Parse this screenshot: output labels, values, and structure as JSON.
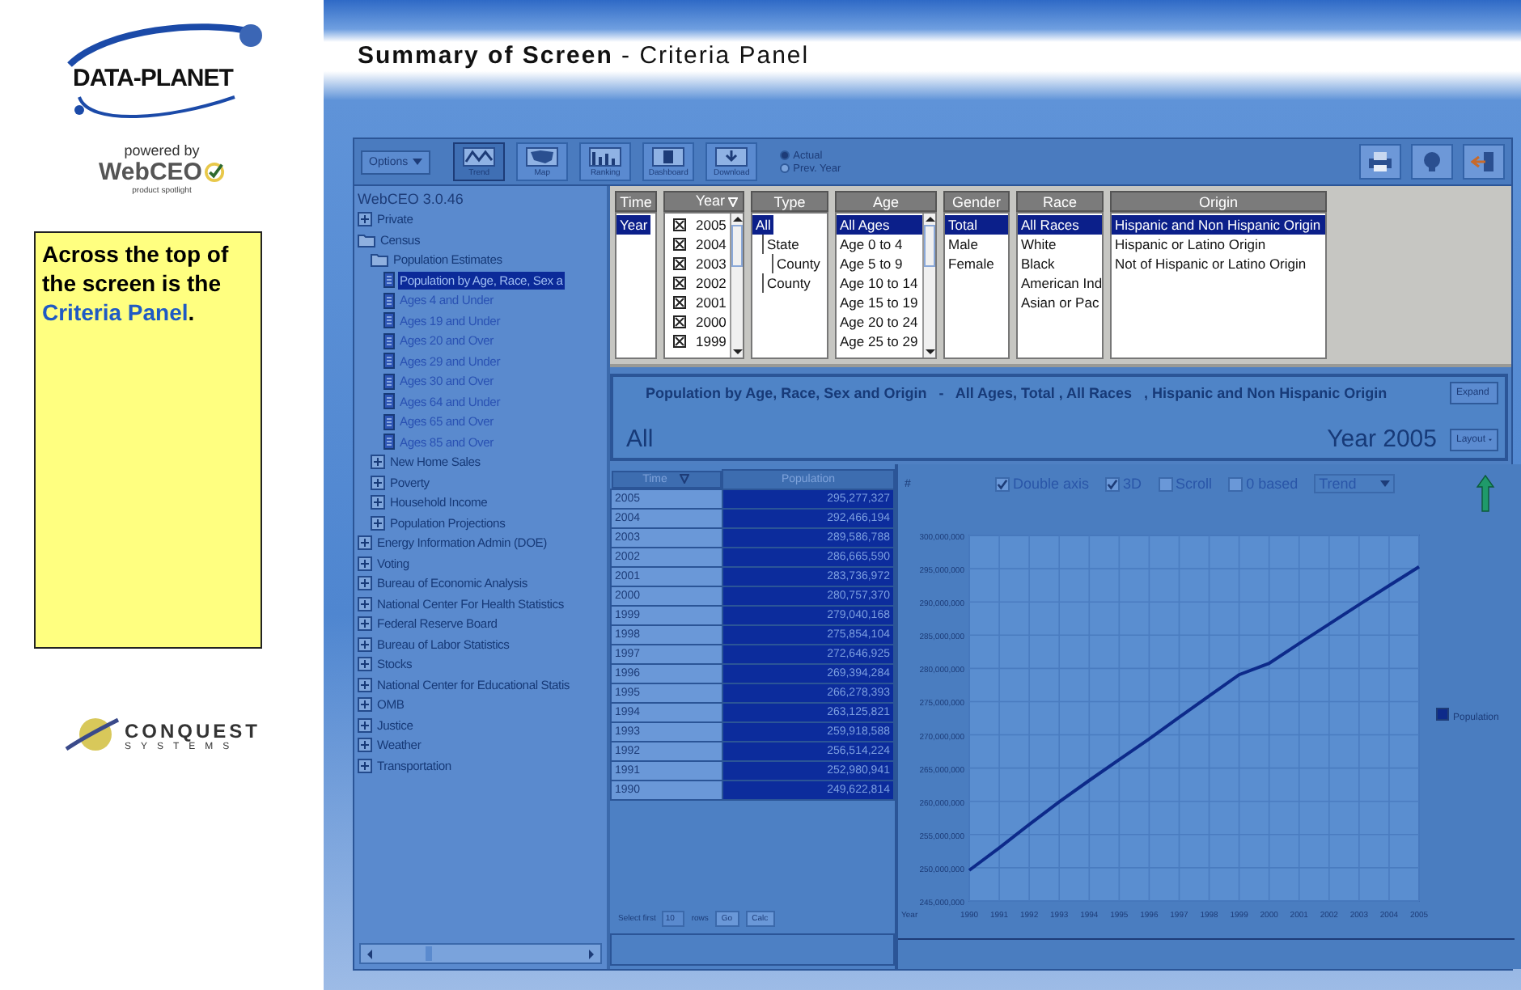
{
  "branding": {
    "logo": "DATA-PLANET",
    "powered_by": "powered by",
    "product": "WebCEO",
    "tagline": "product spotlight",
    "footer_logo": "CONQUEST",
    "footer_sub": "SYSTEMS"
  },
  "note": {
    "text": "Across the top of the screen is the",
    "highlight": "Criteria Panel",
    "end": "."
  },
  "header": {
    "title": "**Summary of Screen** - Criteria Panel"
  },
  "toolbar": {
    "options": "Options",
    "buttons": [
      {
        "label": "Trend",
        "kind": "trend",
        "selected": true
      },
      {
        "label": "Map",
        "kind": "map",
        "selected": false
      },
      {
        "label": "Ranking",
        "kind": "ranking",
        "selected": false
      },
      {
        "label": "Dashboard",
        "kind": "dashboard",
        "selected": false
      },
      {
        "label": "Download",
        "kind": "download",
        "selected": false
      }
    ],
    "radios": [
      {
        "label": "Actual",
        "selected": true
      },
      {
        "label": "Prev. Year",
        "selected": false
      }
    ]
  },
  "tree": {
    "version": "WebCEO 3.0.46",
    "items": [
      {
        "label": "Private",
        "kind": "folder",
        "expanded": false
      },
      {
        "label": "Census",
        "kind": "folder",
        "expanded": true,
        "children": [
          {
            "label": "Population Estimates",
            "kind": "folder",
            "expanded": true,
            "children": [
              {
                "label": "Population by Age, Race, Sex a",
                "kind": "doc",
                "selected": true
              },
              {
                "label": "Ages 4 and Under",
                "kind": "doc",
                "selected": false
              },
              {
                "label": "Ages 19 and Under",
                "kind": "doc",
                "selected": false
              },
              {
                "label": "Ages 20 and Over",
                "kind": "doc",
                "selected": false
              },
              {
                "label": "Ages 29 and Under",
                "kind": "doc",
                "selected": false
              },
              {
                "label": "Ages 30 and Over",
                "kind": "doc",
                "selected": false
              },
              {
                "label": "Ages 64 and Under",
                "kind": "doc",
                "selected": false
              },
              {
                "label": "Ages 65 and Over",
                "kind": "doc",
                "selected": false
              },
              {
                "label": "Ages 85 and Over",
                "kind": "doc",
                "selected": false
              }
            ]
          },
          {
            "label": "New Home Sales",
            "kind": "folder",
            "expanded": false
          },
          {
            "label": "Poverty",
            "kind": "folder",
            "expanded": false
          },
          {
            "label": "Household Income",
            "kind": "folder",
            "expanded": false
          },
          {
            "label": "Population Projections",
            "kind": "folder",
            "expanded": false
          }
        ]
      },
      {
        "label": "Energy Information Admin (DOE)",
        "kind": "folder",
        "expanded": false
      },
      {
        "label": "Voting",
        "kind": "folder",
        "expanded": false
      },
      {
        "label": "Bureau of Economic Analysis",
        "kind": "folder",
        "expanded": false
      },
      {
        "label": "National Center For Health Statistics",
        "kind": "folder",
        "expanded": false
      },
      {
        "label": "Federal Reserve Board",
        "kind": "folder",
        "expanded": false
      },
      {
        "label": "Bureau of Labor Statistics",
        "kind": "folder",
        "expanded": false
      },
      {
        "label": "Stocks",
        "kind": "folder",
        "expanded": false
      },
      {
        "label": "National Center for Educational Statis",
        "kind": "folder",
        "expanded": false
      },
      {
        "label": "OMB",
        "kind": "folder",
        "expanded": false
      },
      {
        "label": "Justice",
        "kind": "folder",
        "expanded": false
      },
      {
        "label": "Weather",
        "kind": "folder",
        "expanded": false
      },
      {
        "label": "Transportation",
        "kind": "folder",
        "expanded": false
      }
    ]
  },
  "criteria": {
    "time": {
      "header": "Time",
      "items": [
        {
          "label": "Year",
          "selected": true
        }
      ]
    },
    "year": {
      "header": "Year",
      "items": [
        {
          "label": "2005",
          "checked": true
        },
        {
          "label": "2004",
          "checked": true
        },
        {
          "label": "2003",
          "checked": true
        },
        {
          "label": "2002",
          "checked": true
        },
        {
          "label": "2001",
          "checked": true
        },
        {
          "label": "2000",
          "checked": true
        },
        {
          "label": "1999",
          "checked": true
        }
      ]
    },
    "type": {
      "header": "Type",
      "items": [
        {
          "label": "All",
          "selected": true,
          "children": [
            {
              "label": "State",
              "selected": false,
              "children": [
                {
                  "label": "County",
                  "selected": false
                }
              ]
            },
            {
              "label": "County",
              "selected": false
            }
          ]
        }
      ]
    },
    "age": {
      "header": "Age",
      "items": [
        {
          "label": "All Ages",
          "selected": true
        },
        {
          "label": "Age 0 to 4",
          "selected": false
        },
        {
          "label": "Age 5 to 9",
          "selected": false
        },
        {
          "label": "Age 10 to 14",
          "selected": false
        },
        {
          "label": "Age 15 to 19",
          "selected": false
        },
        {
          "label": "Age 20 to 24",
          "selected": false
        },
        {
          "label": "Age 25 to 29",
          "selected": false
        }
      ]
    },
    "gender": {
      "header": "Gender",
      "items": [
        {
          "label": "Total",
          "selected": true
        },
        {
          "label": "Male",
          "selected": false
        },
        {
          "label": "Female",
          "selected": false
        }
      ]
    },
    "race": {
      "header": "Race",
      "items": [
        {
          "label": "All Races",
          "selected": true
        },
        {
          "label": "White",
          "selected": false
        },
        {
          "label": "Black",
          "selected": false
        },
        {
          "label": "American Ind",
          "selected": false
        },
        {
          "label": "Asian or Pac",
          "selected": false
        }
      ]
    },
    "origin": {
      "header": "Origin",
      "items": [
        {
          "label": "Hispanic and Non Hispanic Origin",
          "selected": true
        },
        {
          "label": "Hispanic or Latino Origin",
          "selected": false
        },
        {
          "label": "Not of Hispanic or Latino Origin",
          "selected": false
        }
      ]
    }
  },
  "summary": {
    "title": "Population by Age, Race, Sex and Origin   -   All Ages, Total , All Races   , Hispanic and Non Hispanic Origin",
    "scope": "All",
    "period": "Year 2005",
    "expand": "Expand",
    "layout": "Layout"
  },
  "table": {
    "columns": [
      "Time",
      "Population"
    ],
    "rows": [
      {
        "time": "2005",
        "population": "295,277,327"
      },
      {
        "time": "2004",
        "population": "292,466,194"
      },
      {
        "time": "2003",
        "population": "289,586,788"
      },
      {
        "time": "2002",
        "population": "286,665,590"
      },
      {
        "time": "2001",
        "population": "283,736,972"
      },
      {
        "time": "2000",
        "population": "280,757,370"
      },
      {
        "time": "1999",
        "population": "279,040,168"
      },
      {
        "time": "1998",
        "population": "275,854,104"
      },
      {
        "time": "1997",
        "population": "272,646,925"
      },
      {
        "time": "1996",
        "population": "269,394,284"
      },
      {
        "time": "1995",
        "population": "266,278,393"
      },
      {
        "time": "1994",
        "population": "263,125,821"
      },
      {
        "time": "1993",
        "population": "259,918,588"
      },
      {
        "time": "1992",
        "population": "256,514,224"
      },
      {
        "time": "1991",
        "population": "252,980,941"
      },
      {
        "time": "1990",
        "population": "249,622,814"
      }
    ],
    "footer": {
      "select_first": "Select first",
      "count": "10",
      "rows": "rows",
      "go": "Go",
      "calc": "Calc"
    }
  },
  "chart": {
    "options": [
      {
        "label": "Double axis",
        "checked": true
      },
      {
        "label": "3D",
        "checked": true
      },
      {
        "label": "Scroll",
        "checked": false
      },
      {
        "label": "0 based",
        "checked": false
      }
    ],
    "dropdown": "Trend",
    "chart_data": {
      "type": "line",
      "xlabel": "Year",
      "ylabel": "#",
      "grid": true,
      "categories": [
        "1990",
        "1991",
        "1992",
        "1993",
        "1994",
        "1995",
        "1996",
        "1997",
        "1998",
        "1999",
        "2000",
        "2001",
        "2002",
        "2003",
        "2004",
        "2005"
      ],
      "series": [
        {
          "name": "Population",
          "color": "#0d2a8a",
          "values": [
            249622814,
            252980941,
            256514224,
            259918588,
            263125821,
            266278393,
            269394284,
            272646925,
            275854104,
            279040168,
            280757370,
            283736972,
            286665590,
            289586788,
            292466194,
            295277327
          ]
        }
      ],
      "ylim": [
        245000000,
        300000000
      ],
      "yticks": [
        {
          "value": 245000000,
          "label": "245,000,000"
        },
        {
          "value": 250000000,
          "label": "250,000,000"
        },
        {
          "value": 255000000,
          "label": "255,000,000"
        },
        {
          "value": 260000000,
          "label": "260,000,000"
        },
        {
          "value": 265000000,
          "label": "265,000,000"
        },
        {
          "value": 270000000,
          "label": "270,000,000"
        },
        {
          "value": 275000000,
          "label": "275,000,000"
        },
        {
          "value": 280000000,
          "label": "280,000,000"
        },
        {
          "value": 285000000,
          "label": "285,000,000"
        },
        {
          "value": 290000000,
          "label": "290,000,000"
        },
        {
          "value": 295000000,
          "label": "295,000,000"
        },
        {
          "value": 300000000,
          "label": "300,000,000"
        }
      ]
    }
  }
}
